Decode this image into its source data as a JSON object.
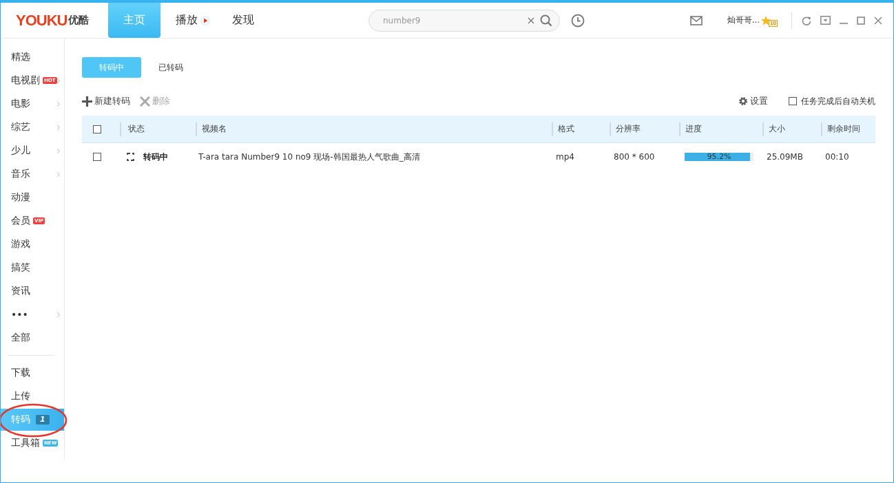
{
  "header": {
    "logo": {
      "brand": "YOUKU",
      "name": "优酷"
    },
    "nav": [
      {
        "label": "主页",
        "selected": true,
        "kind": "plain"
      },
      {
        "label": "播放",
        "selected": false,
        "kind": "play"
      },
      {
        "label": "发现",
        "selected": false,
        "kind": "plain"
      }
    ],
    "search": {
      "value": "number9"
    },
    "user": {
      "name": "灿哥哥...",
      "level": "10"
    }
  },
  "sidebar": {
    "sections": [
      [
        {
          "label": "精选",
          "selected": false,
          "arrow": false
        },
        {
          "label": "电视剧",
          "selected": false,
          "arrow": true,
          "badge": {
            "text": "HOT",
            "kind": "hot"
          }
        },
        {
          "label": "电影",
          "selected": false,
          "arrow": true
        },
        {
          "label": "综艺",
          "selected": false,
          "arrow": true
        },
        {
          "label": "少儿",
          "selected": false,
          "arrow": true
        },
        {
          "label": "音乐",
          "selected": false,
          "arrow": true
        },
        {
          "label": "动漫",
          "selected": false,
          "arrow": false
        },
        {
          "label": "会员",
          "selected": false,
          "arrow": false,
          "badge": {
            "text": "VIP",
            "kind": "hot"
          }
        },
        {
          "label": "游戏",
          "selected": false,
          "arrow": false
        },
        {
          "label": "搞笑",
          "selected": false,
          "arrow": false
        },
        {
          "label": "资讯",
          "selected": false,
          "arrow": false
        },
        {
          "label": "•••",
          "selected": false,
          "arrow": true
        },
        {
          "label": "全部",
          "selected": false,
          "arrow": false
        }
      ],
      [
        {
          "label": "下载",
          "selected": false,
          "arrow": false
        },
        {
          "label": "上传",
          "selected": false,
          "arrow": false
        },
        {
          "label": "转码",
          "selected": true,
          "arrow": false,
          "badge": {
            "text": "1",
            "kind": "count"
          }
        },
        {
          "label": "工具箱",
          "selected": false,
          "arrow": false,
          "badge": {
            "text": "NEW",
            "kind": "new"
          }
        }
      ]
    ]
  },
  "tabs": [
    {
      "label": "转码中",
      "selected": true
    },
    {
      "label": "已转码",
      "selected": false
    }
  ],
  "toolbar": {
    "actions": [
      {
        "label": "新建转码",
        "kind": "add",
        "disabled": false
      },
      {
        "label": "删除",
        "kind": "delete",
        "disabled": true
      }
    ],
    "settings": "设置",
    "auto_shutdown": {
      "label": "任务完成后自动关机",
      "checked": false
    }
  },
  "table": {
    "select_all": false,
    "columns": [
      "状态",
      "视频名",
      "格式",
      "分辨率",
      "进度",
      "大小",
      "剩余时间"
    ],
    "rows": [
      {
        "checked": false,
        "status": "转码中",
        "name": "T-ara tara Number9 10 no9 现场-韩国最热人气歌曲_高清",
        "format": "mp4",
        "resolution": "800 * 600",
        "progress": {
          "level": 0.952,
          "text": "95.2%"
        },
        "size": "25.09MB",
        "remaining": "00:10"
      }
    ]
  }
}
